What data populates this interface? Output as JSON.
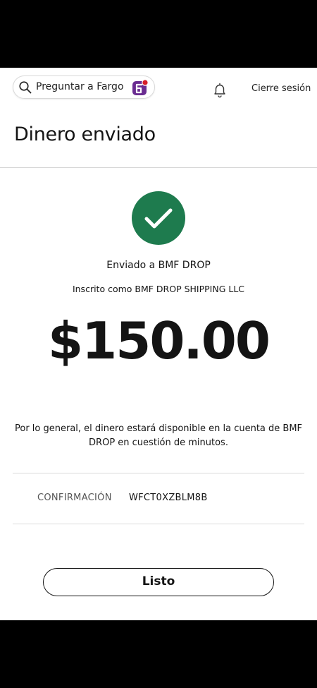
{
  "header": {
    "search_label": "Preguntar a Fargo",
    "logout_label": "Cierre sesión"
  },
  "page": {
    "title": "Dinero enviado"
  },
  "confirmation": {
    "sent_to": "Enviado a BMF DROP",
    "registered_as": "Inscrito como BMF DROP SHIPPING LLC",
    "amount": "$150.00",
    "availability": "Por lo general, el dinero estará disponible en la cuenta de BMF DROP en cuestión de minutos.",
    "label": "CONFIRMACIÓN",
    "code": "WFCT0XZBLM8B"
  },
  "actions": {
    "done_label": "Listo"
  },
  "colors": {
    "success_green": "#1e7b4e",
    "fargo_purple": "#6a2c91",
    "fargo_red": "#d71e28"
  },
  "icons": {
    "search": "search-icon",
    "fargo": "fargo-icon",
    "notifications": "bell-icon",
    "success": "checkmark-icon"
  }
}
